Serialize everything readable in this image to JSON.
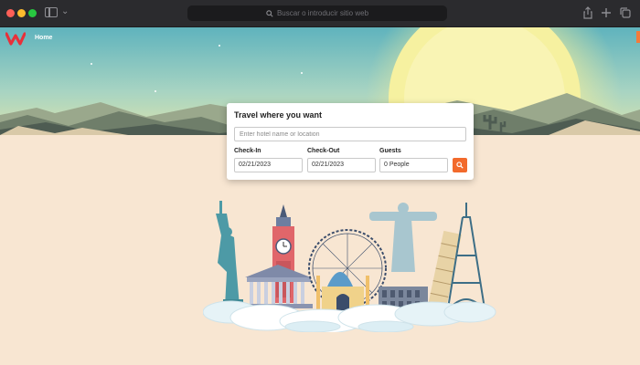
{
  "browser": {
    "url_placeholder": "Buscar o introducir sitio web",
    "icons": [
      "sidebar-icon",
      "chevron-down-icon",
      "search-icon",
      "share-icon",
      "plus-icon",
      "tabs-icon"
    ]
  },
  "header": {
    "logo_label": "W",
    "nav_home": "Home"
  },
  "search": {
    "title": "Travel where you want",
    "location_placeholder": "Enter hotel name or location",
    "checkin_label": "Check-In",
    "checkin_value": "02/21/2023",
    "checkout_label": "Check-Out",
    "checkout_value": "02/21/2023",
    "guests_label": "Guests",
    "guests_value": "0 People",
    "button_icon": "search-icon"
  },
  "colors": {
    "brand": "#e8303a",
    "accent": "#f26a2c",
    "page_bg": "#f8e6d2",
    "sky": "#7fc3c9"
  }
}
